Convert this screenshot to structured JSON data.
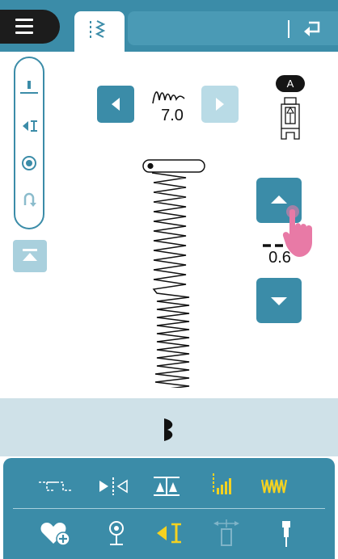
{
  "stitch": {
    "width_value": "7.0",
    "length_value": "0.6"
  },
  "presser_foot": {
    "label": "A"
  },
  "colors": {
    "primary": "#3b8ca8",
    "primary_light": "#b9dbe6",
    "active_yellow": "#f5d220",
    "dark": "#1c1c1c",
    "info_bar": "#cfe1e8",
    "pointer_pink": "#e87aa6"
  },
  "toolbar": {
    "row1": [
      "tacking-icon",
      "mirror-horizontal-icon",
      "balance-icon",
      "stitch-length-icon",
      "stitch-density-icon"
    ],
    "row2": [
      "favorite-add-icon",
      "position-pin-icon",
      "start-pattern-icon",
      "width-limit-icon",
      "needle-icon"
    ]
  }
}
